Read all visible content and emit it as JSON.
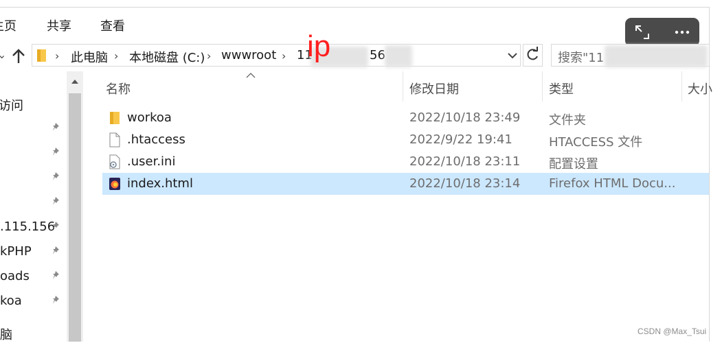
{
  "ribbon": {
    "tabs": [
      "主页",
      "共享",
      "查看"
    ]
  },
  "address_bar": {
    "crumbs": [
      "此电脑",
      "本地磁盘 (C:)",
      "wwwroot",
      "11",
      "56"
    ],
    "annotation": "ip"
  },
  "search": {
    "placeholder": "搜索\"11"
  },
  "sidebar": {
    "items": [
      {
        "label": "访问"
      },
      {
        "label": ""
      },
      {
        "label": ""
      },
      {
        "label": ""
      },
      {
        "label": ""
      },
      {
        "label": ".115.156"
      },
      {
        "label": "kPHP"
      },
      {
        "label": "oads"
      },
      {
        "label": "koa"
      },
      {
        "label": "脑"
      }
    ]
  },
  "columns": {
    "name": "名称",
    "modified": "修改日期",
    "type": "类型",
    "size": "大小"
  },
  "files": [
    {
      "name": "workoa",
      "modified": "2022/10/18 23:49",
      "type": "文件夹",
      "icon": "folder-icon",
      "selected": false
    },
    {
      "name": ".htaccess",
      "modified": "2022/9/22 19:41",
      "type": "HTACCESS 文件",
      "icon": "file-icon",
      "selected": false
    },
    {
      "name": ".user.ini",
      "modified": "2022/10/18 23:11",
      "type": "配置设置",
      "icon": "config-file-icon",
      "selected": false
    },
    {
      "name": "index.html",
      "modified": "2022/10/18 23:14",
      "type": "Firefox HTML Docu...",
      "icon": "firefox-html-icon",
      "selected": true
    }
  ],
  "watermark": "CSDN @Max_Tsui",
  "colors": {
    "selection": "#cce8ff",
    "annotation": "#ff1e1e",
    "folder": "#f8c74a"
  }
}
